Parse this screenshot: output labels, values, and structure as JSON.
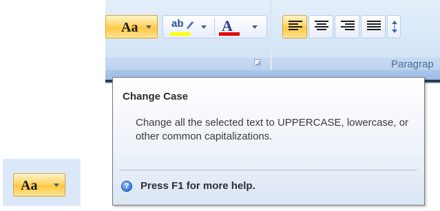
{
  "ribbon": {
    "font_group": {
      "change_case_label": "Aa",
      "highlight_label": "ab",
      "font_color_label": "A"
    },
    "paragraph_group": {
      "label": "Paragrap"
    }
  },
  "tooltip": {
    "title": "Change Case",
    "description": "Change all the selected text to UPPERCASE, lowercase, or other common capitalizations.",
    "help_text": "Press F1 for more help.",
    "help_icon": "help-question-icon"
  },
  "zoomed_button": {
    "label": "Aa"
  },
  "colors": {
    "accent_hover": "#ffd66a",
    "highlight_bar": "#ffff00",
    "font_color_bar": "#e60000",
    "ribbon_bg": "#d6e6f8"
  }
}
